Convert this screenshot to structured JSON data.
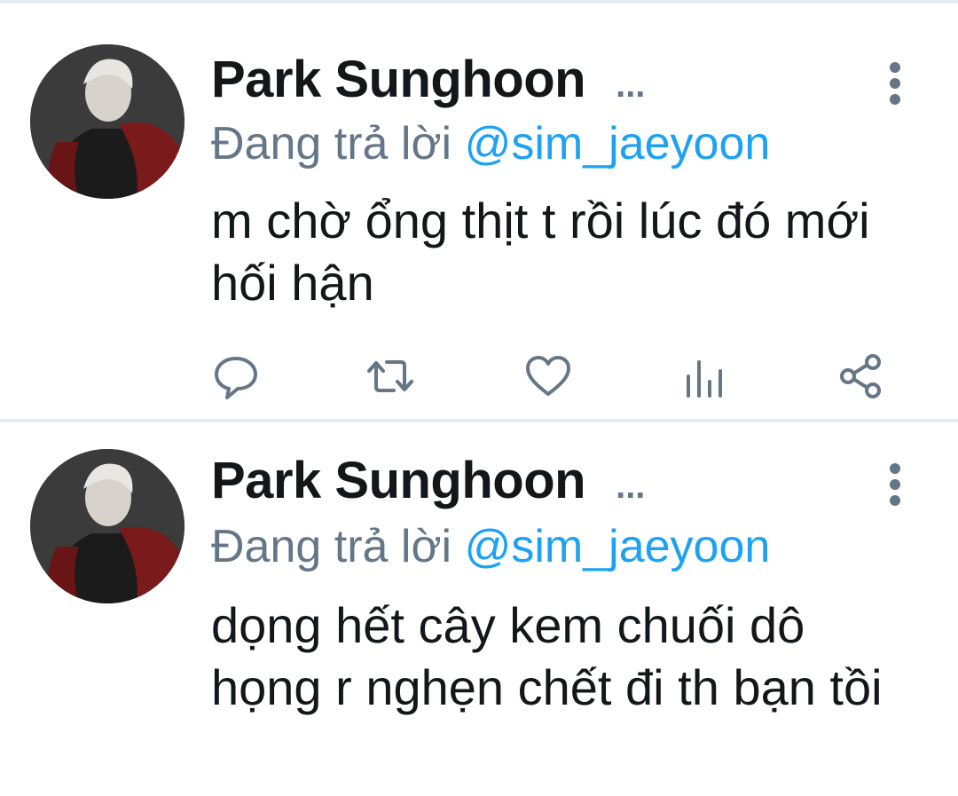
{
  "colors": {
    "name": "#14171a",
    "secondary": "#657786",
    "mention": "#1da1f2",
    "text": "#14171a",
    "separator": "#e6ecf0"
  },
  "tweets": [
    {
      "author": "Park Sunghoon",
      "ellipsis": "...",
      "reply_prefix": "Đang trả lời",
      "reply_handle": "@sim_jaeyoon",
      "text": "m chờ ổng thịt t rồi lúc đó mới hối hận",
      "actions": [
        "reply-icon",
        "retweet-icon",
        "like-icon",
        "analytics-icon",
        "share-icon"
      ]
    },
    {
      "author": "Park Sunghoon",
      "ellipsis": "...",
      "reply_prefix": "Đang trả lời",
      "reply_handle": "@sim_jaeyoon",
      "text": "dọng hết cây kem chuối dô họng r nghẹn chết đi th bạn tồi"
    }
  ]
}
